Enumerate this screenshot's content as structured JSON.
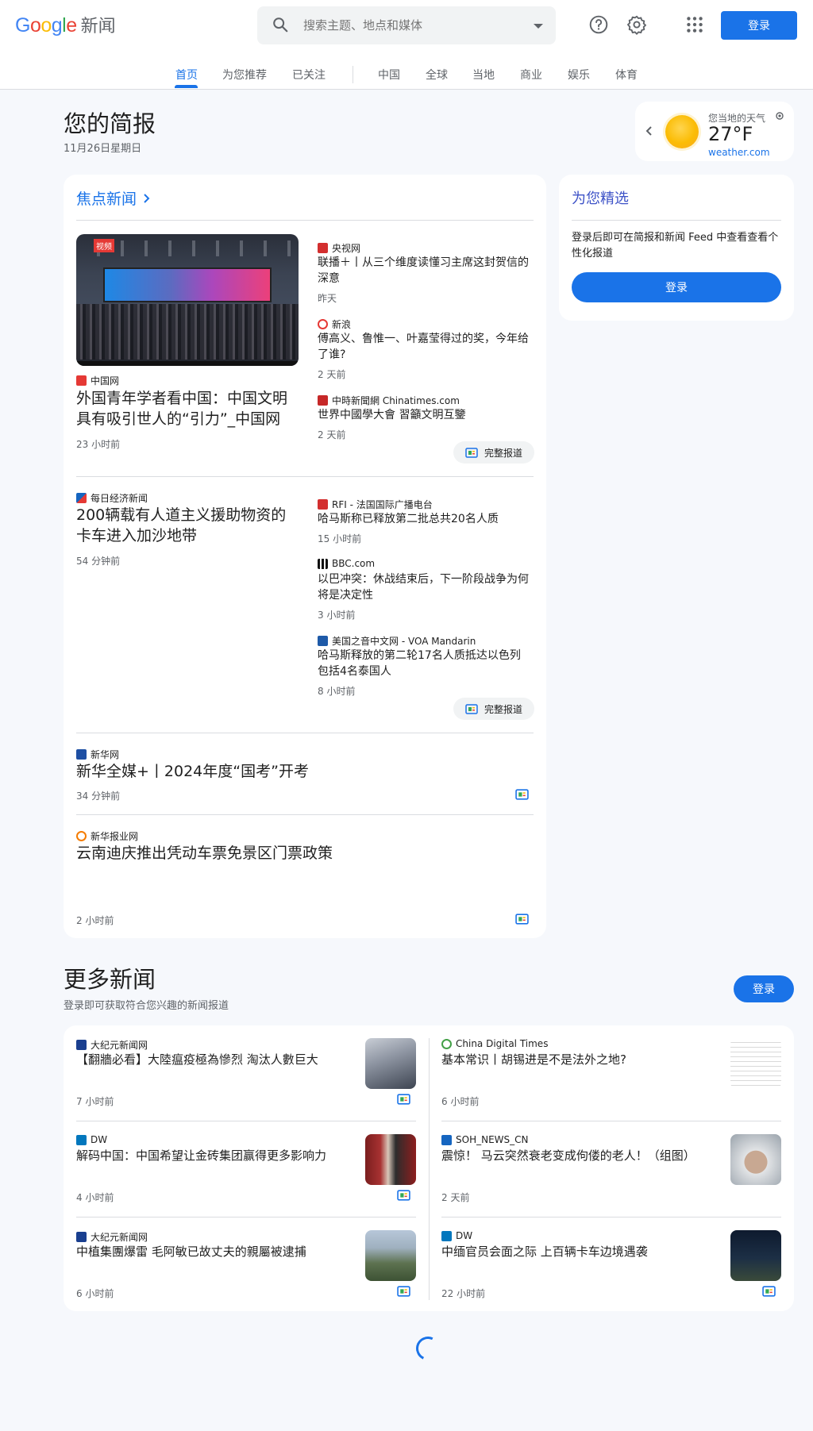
{
  "header": {
    "logo_google": "Google",
    "logo_news": "新闻",
    "search_placeholder": "搜索主题、地点和媒体",
    "signin_label": "登录",
    "icons": [
      "search-icon",
      "help-icon",
      "settings-icon",
      "apps-icon"
    ]
  },
  "nav": {
    "tabs": [
      {
        "label": "首页",
        "active": true
      },
      {
        "label": "为您推荐"
      },
      {
        "label": "已关注"
      },
      {
        "label": "中国"
      },
      {
        "label": "全球"
      },
      {
        "label": "当地"
      },
      {
        "label": "商业"
      },
      {
        "label": "娱乐"
      },
      {
        "label": "体育"
      }
    ]
  },
  "briefing": {
    "title": "您的简报",
    "date": "11月26日星期日"
  },
  "weather": {
    "label": "您当地的天气",
    "temp": "27°F",
    "source": "weather.com"
  },
  "top_stories": {
    "title": "焦点新闻",
    "full_coverage": "完整报道",
    "cluster1": {
      "main": {
        "source": "中国网",
        "headline": "外国青年学者看中国：中国文明具有吸引世人的“引力”_中国网",
        "time": "23 小时前",
        "image_tag": "视频"
      },
      "side": [
        {
          "source": "央视网",
          "headline": "联播＋丨从三个维度读懂习主席这封贺信的深意",
          "time": "昨天"
        },
        {
          "source": "新浪",
          "headline": "傅高义、鲁惟一、叶嘉莹得过的奖，今年给了谁?",
          "time": "2 天前"
        },
        {
          "source": "中時新聞網 Chinatimes.com",
          "headline": "世界中國學大會 習籲文明互鑒",
          "time": "2 天前"
        }
      ]
    },
    "cluster2": {
      "main": {
        "source": "每日经济新闻",
        "headline": "200辆载有人道主义援助物资的卡车进入加沙地带",
        "time": "54 分钟前"
      },
      "side": [
        {
          "source": "RFI - 法国国际广播电台",
          "headline": "哈马斯称已释放第二批总共20名人质",
          "time": "15 小时前"
        },
        {
          "source": "BBC.com",
          "headline": "以巴冲突：休战结束后，下一阶段战争为何将是决定性",
          "time": "3 小时前"
        },
        {
          "source": "美国之音中文网 - VOA Mandarin",
          "headline": "哈马斯释放的第二轮17名人质抵达以色列 包括4名泰国人",
          "time": "8 小时前"
        }
      ]
    },
    "single1": {
      "source": "新华网",
      "headline": "新华全媒+丨2024年度“国考”开考",
      "time": "34 分钟前"
    },
    "single2": {
      "source": "新华报业网",
      "headline": "云南迪庆推出凭动车票免景区门票政策",
      "time": "2 小时前"
    }
  },
  "picks": {
    "title": "为您精选",
    "description": "登录后即可在简报和新闻 Feed 中查看查看个性化报道",
    "signin_label": "登录"
  },
  "more": {
    "title": "更多新闻",
    "subtitle": "登录即可获取符合您兴趣的新闻报道",
    "signin_label": "登录",
    "left": [
      {
        "source": "大纪元新闻网",
        "headline": "【翻牆必看】大陸瘟疫極為慘烈 淘汰人數巨大",
        "time": "7 小时前"
      },
      {
        "source": "DW",
        "headline": "解码中国：中国希望让金砖集团赢得更多影响力",
        "time": "4 小时前"
      },
      {
        "source": "大纪元新闻网",
        "headline": "中植集團爆雷 毛阿敏已故丈夫的親屬被逮捕",
        "time": "6 小时前"
      }
    ],
    "right": [
      {
        "source": "China Digital Times",
        "headline": "基本常识丨胡锡进是不是法外之地?",
        "time": "6 小时前"
      },
      {
        "source": "SOH_NEWS_CN",
        "headline": "震惊！ 马云突然衰老变成佝偻的老人！（组图）",
        "time": "2 天前"
      },
      {
        "source": "DW",
        "headline": "中缅官员会面之际 上百辆卡车边境遇袭",
        "time": "22 小时前"
      }
    ]
  },
  "colors": {
    "accent": "#1a73e8",
    "picks_title": "#3d52c7",
    "background": "#f6f8fc"
  }
}
